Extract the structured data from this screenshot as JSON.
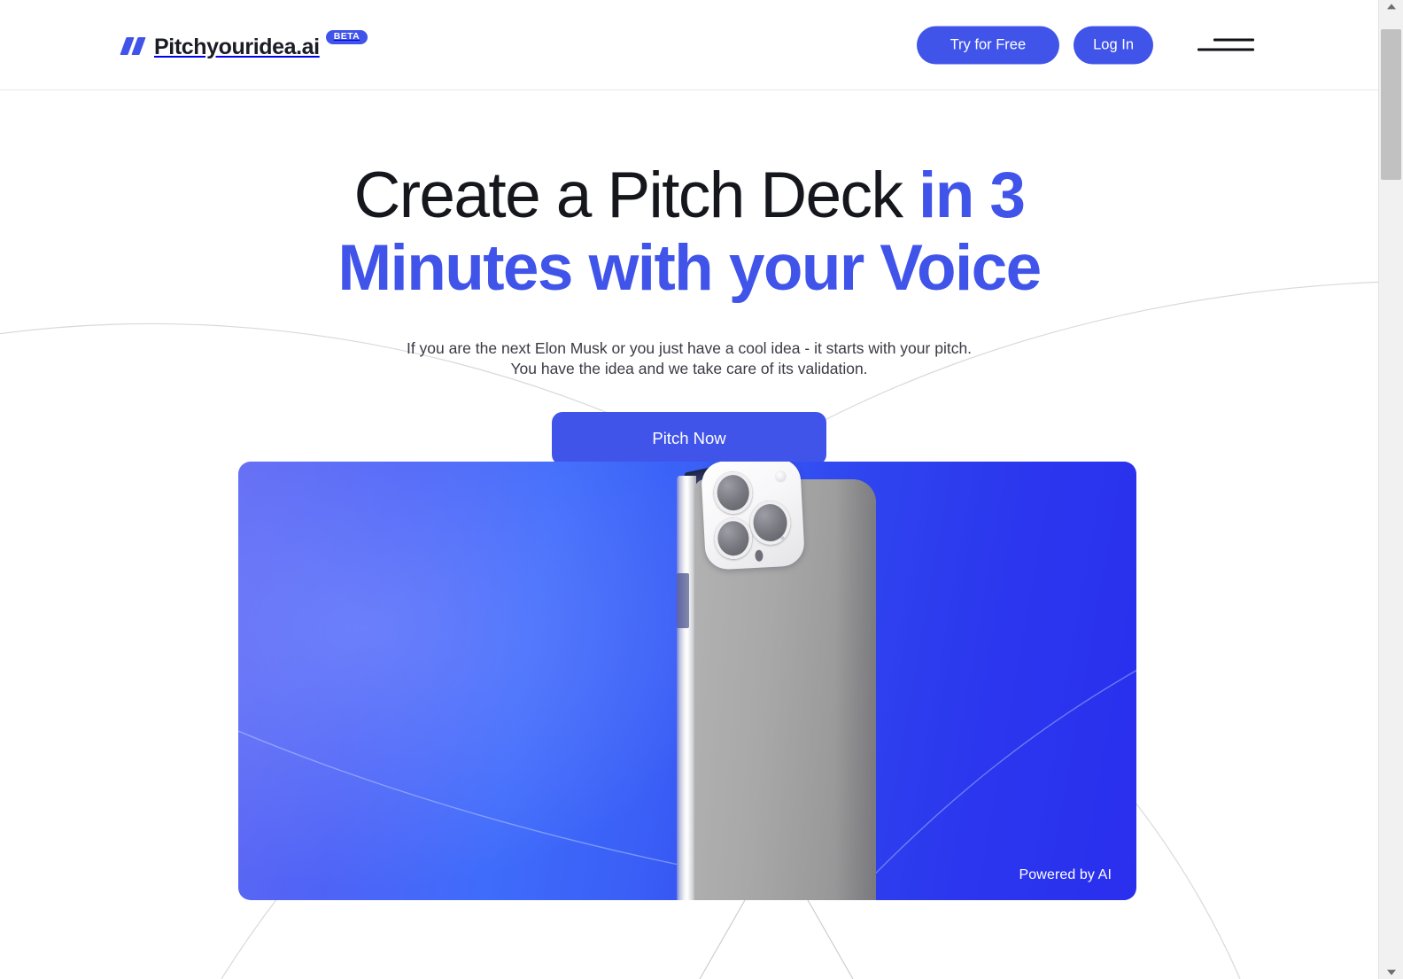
{
  "brand": {
    "name": "Pitchyouridea.ai",
    "badge": "BETA",
    "logo_icon": "double-slash-logo-icon",
    "accent_color": "#4054ea"
  },
  "header": {
    "try_free_label": "Try for Free",
    "login_label": "Log In",
    "menu_icon": "hamburger-menu-icon"
  },
  "hero": {
    "title_plain": "Create a Pitch Deck ",
    "title_accent_1": "in 3",
    "title_accent_2": "Minutes with your Voice",
    "subtitle_line_1": "If you are the next Elon Musk or you just have a cool idea - it starts with your pitch.",
    "subtitle_line_2": "You have the idea and we take care of its validation.",
    "cta_label": "Pitch Now"
  },
  "media": {
    "caption": "Powered by AI",
    "subject": "smartphone-back-with-triple-camera",
    "gradient_from": "#6169f3",
    "gradient_to": "#2a2fee"
  },
  "scrollbar": {
    "up_icon": "scroll-up-arrow-icon",
    "down_icon": "scroll-down-arrow-icon"
  }
}
